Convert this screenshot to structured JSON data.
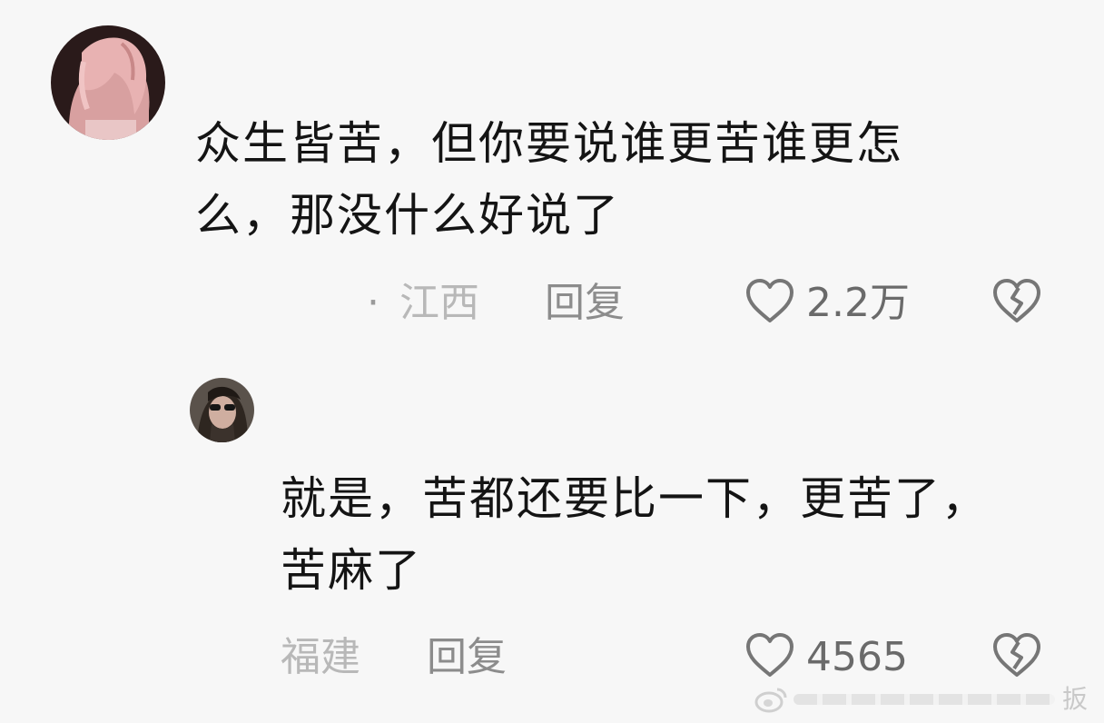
{
  "comments": [
    {
      "text_lines": [
        "众生皆苦，但你要说谁更苦谁更怎",
        "么，那没什么好说了"
      ],
      "location": "江西",
      "reply_label": "回复",
      "like_count": "2.2万",
      "avatar_icon": "anime-girl-avatar"
    },
    {
      "text_lines": [
        "就是，苦都还要比一下，更苦了，",
        "苦麻了"
      ],
      "location": "福建",
      "reply_label": "回复",
      "like_count": "4565",
      "avatar_icon": "sunglasses-person-avatar"
    }
  ],
  "icons": {
    "like": "heart-outline-icon",
    "dislike": "broken-heart-icon",
    "watermark": "weibo-logo-icon"
  },
  "watermark": {
    "text": "扳"
  },
  "colors": {
    "background": "#f7f7f7",
    "text": "#141414",
    "meta": "#8c8c8c",
    "meta_light": "#b8b8b8"
  }
}
